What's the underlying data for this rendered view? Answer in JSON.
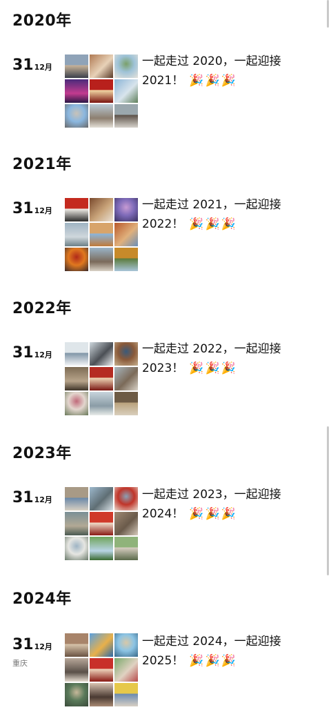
{
  "posts": [
    {
      "year": "2020年",
      "day": "31",
      "month": "12月",
      "location": "",
      "caption": "一起走过 2020，一起迎接 2021！",
      "photos": [
        {
          "name": "photo-couple-street",
          "colors": [
            "#8fa3b8",
            "#c9b49a",
            "#3a3f4a"
          ]
        },
        {
          "name": "photo-couple-restaurant",
          "colors": [
            "#b07a53",
            "#e8d2b8",
            "#5a3a28"
          ]
        },
        {
          "name": "photo-couple-park",
          "colors": [
            "#9fc3d8",
            "#7aa06a",
            "#e6e2da"
          ]
        },
        {
          "name": "photo-purple-stage",
          "colors": [
            "#4b2a7a",
            "#c23b8f",
            "#2a1846"
          ]
        },
        {
          "name": "photo-red-gate",
          "colors": [
            "#b8201c",
            "#f3d9a6",
            "#7a1410"
          ]
        },
        {
          "name": "photo-mountain-lake",
          "colors": [
            "#8cb4d6",
            "#d8e4ec",
            "#5f7f5a"
          ]
        },
        {
          "name": "photo-monument-sky",
          "colors": [
            "#8ab7e0",
            "#c8c2b8",
            "#6a6a6a"
          ]
        },
        {
          "name": "photo-couple-square",
          "colors": [
            "#b9c9d6",
            "#8d7f70",
            "#e4e0d8"
          ]
        },
        {
          "name": "photo-couple-stairs",
          "colors": [
            "#9aa7ad",
            "#5b5048",
            "#d6d2cb"
          ]
        }
      ]
    },
    {
      "year": "2021年",
      "day": "31",
      "month": "12月",
      "location": "",
      "caption": "一起走过 2021，一起迎接 2022！",
      "photos": [
        {
          "name": "photo-couple-red-backdrop",
          "colors": [
            "#c42a1f",
            "#f2efe9",
            "#2b2b2b"
          ]
        },
        {
          "name": "photo-ancient-tower",
          "colors": [
            "#7a4a2e",
            "#c9a47a",
            "#e9e0d3"
          ]
        },
        {
          "name": "photo-purple-dusk-city",
          "colors": [
            "#7d6ab8",
            "#c79bd3",
            "#3a3160"
          ]
        },
        {
          "name": "photo-coast-overcast",
          "colors": [
            "#9fb3c2",
            "#cfd7dc",
            "#6b7f86"
          ]
        },
        {
          "name": "photo-desert-road",
          "colors": [
            "#d8a46a",
            "#8ab6de",
            "#c07a3a"
          ]
        },
        {
          "name": "photo-canyon-red",
          "colors": [
            "#b8582a",
            "#e0b07c",
            "#6b8fb8"
          ]
        },
        {
          "name": "photo-orange-lanterns",
          "colors": [
            "#e0781f",
            "#b02a1a",
            "#3a2a2a"
          ]
        },
        {
          "name": "photo-pagoda-road",
          "colors": [
            "#9ab4c8",
            "#7a6a5a",
            "#d9d2c6"
          ]
        },
        {
          "name": "photo-autumn-hill",
          "colors": [
            "#c78a2a",
            "#5a7a3a",
            "#a8c4d8"
          ]
        },
        {
          "name": "photo-village-houses",
          "colors": [
            "#8aa0ad",
            "#b7a48e",
            "#4c5a4a"
          ]
        },
        {
          "name": "photo-couple-masks",
          "colors": [
            "#c8b8a8",
            "#5a4a42",
            "#e6e1db"
          ]
        },
        {
          "name": "photo-couple-gate",
          "colors": [
            "#6a8a6a",
            "#b8a890",
            "#e0dccf"
          ]
        }
      ]
    },
    {
      "year": "2022年",
      "day": "31",
      "month": "12月",
      "location": "",
      "caption": "一起走过 2022，一起迎接 2023！",
      "photos": [
        {
          "name": "photo-snow-field",
          "colors": [
            "#dfe6ea",
            "#7e94a6",
            "#f3f4f6"
          ]
        },
        {
          "name": "photo-snow-couple",
          "colors": [
            "#cfd8de",
            "#4b4f55",
            "#eef1f3"
          ]
        },
        {
          "name": "photo-temple-roof",
          "colors": [
            "#8a5a3a",
            "#3a5a7a",
            "#c6b08e"
          ]
        },
        {
          "name": "photo-hall-interior",
          "colors": [
            "#7d6b54",
            "#b7a48a",
            "#3e3428"
          ]
        },
        {
          "name": "photo-red-card",
          "colors": [
            "#b52b22",
            "#f0d9b8",
            "#7a1612"
          ]
        },
        {
          "name": "photo-courtyard-flag",
          "colors": [
            "#a8b6bf",
            "#7b6a58",
            "#d8d2c8"
          ]
        },
        {
          "name": "photo-couple-flowers",
          "colors": [
            "#e3d6ce",
            "#c06a7a",
            "#6a7a5a"
          ]
        },
        {
          "name": "photo-lake-shore",
          "colors": [
            "#c7d4dc",
            "#8a9ca6",
            "#e9ece9"
          ]
        },
        {
          "name": "photo-archway",
          "colors": [
            "#6d5b45",
            "#b9a27c",
            "#d9cfbd"
          ]
        }
      ]
    },
    {
      "year": "2023年",
      "day": "31",
      "month": "12月",
      "location": "",
      "caption": "一起走过 2023，一起迎接 2024！",
      "photos": [
        {
          "name": "photo-old-city-wall",
          "colors": [
            "#a89a86",
            "#6a88a8",
            "#d8d0c2"
          ]
        },
        {
          "name": "photo-river-town",
          "colors": [
            "#9cb8cc",
            "#5f6e74",
            "#dbe3e8"
          ]
        },
        {
          "name": "photo-red-lantern-street",
          "colors": [
            "#c0352a",
            "#8aa0b4",
            "#e8dcd0"
          ]
        },
        {
          "name": "photo-mountain-road",
          "colors": [
            "#7a8f96",
            "#b2a995",
            "#4a5a52"
          ]
        },
        {
          "name": "photo-red-poster",
          "colors": [
            "#d03a2a",
            "#f2e0cc",
            "#8a1a14"
          ]
        },
        {
          "name": "photo-stone-lion",
          "colors": [
            "#a08a74",
            "#6a5a4a",
            "#d6cbbc"
          ]
        },
        {
          "name": "photo-white-building",
          "colors": [
            "#e6e6e2",
            "#9eb4c4",
            "#6a7a6a"
          ]
        },
        {
          "name": "photo-green-lawn",
          "colors": [
            "#6fa45a",
            "#b8d4e4",
            "#3a6a30"
          ]
        },
        {
          "name": "photo-couple-grass",
          "colors": [
            "#8fb37a",
            "#d8cfc2",
            "#5a6a4a"
          ]
        }
      ]
    },
    {
      "year": "2024年",
      "day": "31",
      "month": "12月",
      "location": "重庆",
      "caption": "一起走过 2024，一起迎接 2025！",
      "photos": [
        {
          "name": "photo-bookshelf-collage",
          "colors": [
            "#a8846a",
            "#d9c6ac",
            "#6a5242"
          ]
        },
        {
          "name": "photo-blue-sky-field",
          "colors": [
            "#5aa0e0",
            "#e8b04a",
            "#2a6aa8"
          ]
        },
        {
          "name": "photo-seaside-couple",
          "colors": [
            "#8cc4e4",
            "#d8c8a8",
            "#3a6a8a"
          ]
        },
        {
          "name": "photo-street-crowd",
          "colors": [
            "#b8a89a",
            "#5a5048",
            "#e6dcd0"
          ]
        },
        {
          "name": "photo-red-banner",
          "colors": [
            "#c8302a",
            "#f0d8c0",
            "#8a1a14"
          ]
        },
        {
          "name": "photo-garden-friends",
          "colors": [
            "#7aa86a",
            "#e0d2c2",
            "#b84a4a"
          ]
        },
        {
          "name": "photo-old-gate-green",
          "colors": [
            "#5a7a5a",
            "#c6b89a",
            "#3a4a3a"
          ]
        },
        {
          "name": "photo-couple-selfie",
          "colors": [
            "#d8c2b0",
            "#4a3a32",
            "#a88a74"
          ]
        },
        {
          "name": "photo-friends-yellow",
          "colors": [
            "#e6c84a",
            "#6a8ab0",
            "#d8d0c4"
          ]
        }
      ]
    }
  ]
}
